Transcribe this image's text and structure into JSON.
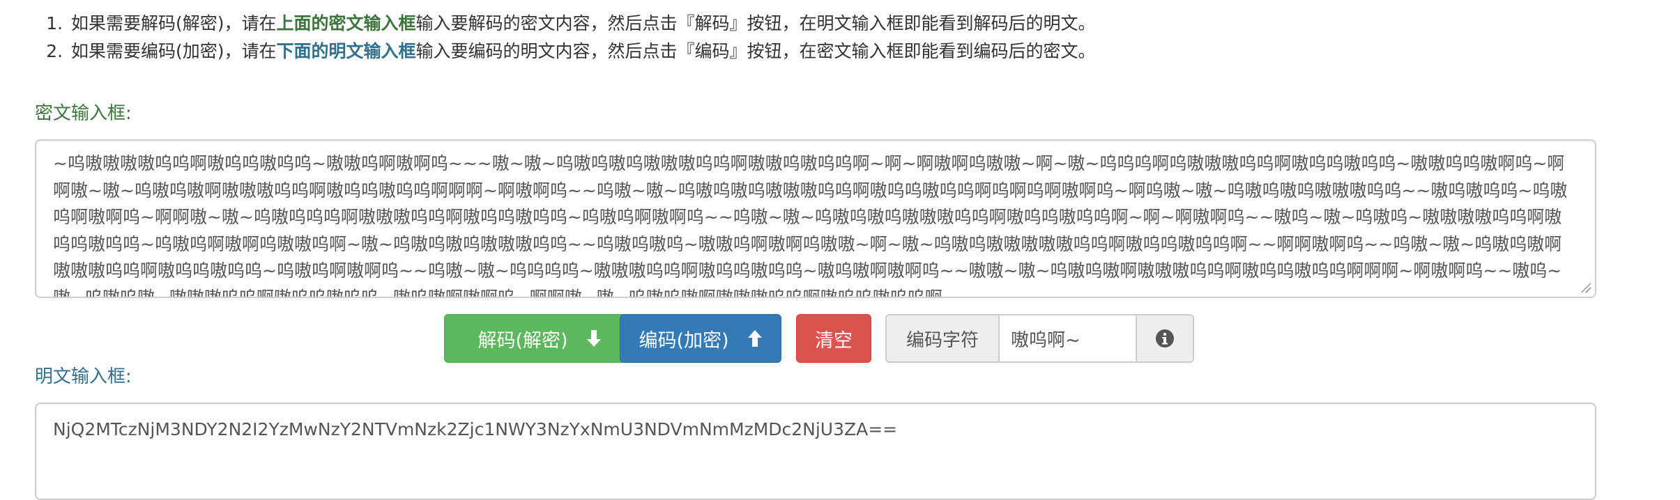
{
  "instructions": [
    {
      "prefix": "如果需要解码(解密)，请在",
      "highlight": "上面的密文输入框",
      "suffix": "输入要解码的密文内容，然后点击『解码』按钮，在明文输入框即能看到解码后的明文。"
    },
    {
      "prefix": "如果需要编码(加密)，请在",
      "highlight": "下面的明文输入框",
      "suffix": "输入要编码的明文内容，然后点击『编码』按钮，在密文输入框即能看到编码后的密文。"
    }
  ],
  "cipher": {
    "label": "密文输入框:",
    "value": "~呜嗷嗷嗷嗷呜呜啊嗷呜呜嗷呜呜~嗷嗷呜啊嗷啊呜~~~嗷~嗷~呜嗷呜嗷呜嗷嗷嗷呜呜啊嗷嗷呜嗷呜呜啊~啊~啊嗷啊呜嗷嗷~啊~嗷~呜呜呜啊呜嗷嗷嗷呜呜啊嗷呜呜嗷呜呜~嗷嗷呜呜嗷啊呜~啊啊嗷~嗷~呜嗷呜嗷啊嗷嗷嗷呜呜啊嗷呜呜嗷呜呜啊啊啊~啊嗷啊呜~~呜嗷~嗷~呜嗷呜嗷呜嗷嗷嗷呜呜啊嗷呜呜嗷呜呜啊呜啊呜啊嗷啊呜~啊呜嗷~嗷~呜嗷呜嗷呜嗷嗷嗷呜呜~~嗷呜嗷呜呜~呜嗷呜啊嗷啊呜~啊啊嗷~嗷~呜嗷呜呜呜啊嗷嗷嗷呜呜啊嗷呜呜嗷呜呜~呜嗷呜啊嗷啊呜~~呜嗷~嗷~呜嗷呜嗷呜嗷嗷嗷呜呜啊嗷呜呜嗷呜呜啊~啊~啊嗷啊呜~~嗷呜~嗷~呜嗷呜~嗷嗷嗷嗷呜呜啊嗷呜呜嗷呜呜~呜嗷呜啊嗷啊呜嗷嗷呜啊~嗷~呜嗷呜嗷呜嗷嗷嗷呜呜~~呜嗷呜嗷呜~嗷嗷呜啊嗷啊呜嗷嗷~啊~嗷~呜嗷呜嗷嗷嗷嗷嗷呜呜啊嗷呜呜嗷呜呜啊~~啊啊嗷啊呜~~呜嗷~嗷~呜嗷呜嗷啊嗷嗷嗷呜呜啊嗷呜呜嗷呜呜~呜嗷呜啊嗷啊呜~~呜嗷~嗷~呜呜呜呜~嗷嗷嗷呜呜啊嗷呜呜嗷呜呜~嗷呜嗷啊嗷啊呜~~嗷嗷~嗷~呜嗷呜嗷啊嗷嗷嗷呜呜啊嗷呜呜嗷呜呜啊啊啊~啊嗷啊呜~~嗷呜~嗷~呜嗷呜嗷~嗷嗷嗷呜呜啊嗷呜呜嗷呜呜~嗷呜嗷啊嗷啊呜~啊啊嗷~嗷~呜嗷呜嗷啊嗷嗷嗷呜呜啊嗷呜呜嗷呜呜啊"
  },
  "buttons": {
    "decode": "解码(解密)",
    "encode": "编码(加密)",
    "clear": "清空"
  },
  "charset": {
    "label": "编码字符",
    "value": "嗷呜啊~"
  },
  "plain": {
    "label": "明文输入框:",
    "value": "NjQ2MTczNjM3NDY2N2I2YzMwNzY2NTVmNzk2Zjc1NWY3NzYxNmU3NDVmNmMzMDc2NjU3ZA=="
  },
  "colors": {
    "decode": "#5cb85c",
    "encode": "#337ab7",
    "clear": "#d9534f",
    "cipher_label": "#3c763d",
    "plain_label": "#31708f"
  },
  "icons": {
    "decode": "arrow-down-icon",
    "encode": "arrow-up-icon",
    "info": "info-circle-icon"
  }
}
